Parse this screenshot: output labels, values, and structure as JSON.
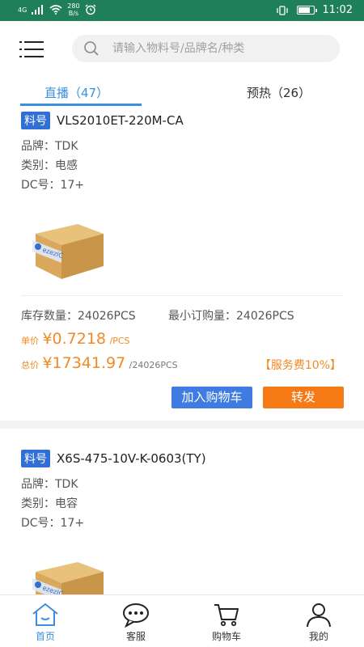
{
  "status_bar": {
    "network": "4G",
    "net_speed_value": "280",
    "net_speed_unit": "B/s",
    "time": "11:02"
  },
  "search": {
    "placeholder": "请输入物料号/品牌名/种类"
  },
  "tabs": [
    {
      "label": "直播（47）",
      "active": true
    },
    {
      "label": "预热（26）",
      "active": false
    }
  ],
  "products": [
    {
      "badge": "料号",
      "part_number": "VLS2010ET-220M-CA",
      "brand": "品牌：TDK",
      "category": "类别：电感",
      "dc": "DC号：17+",
      "stock": "库存数量：24026PCS",
      "moq": "最小订购量：24026PCS",
      "unit_price_label": "单价",
      "unit_price": "¥0.7218",
      "unit_price_unit": "/PCS",
      "total_label": "总价",
      "total_price": "¥17341.97",
      "total_qty": "/24026PCS",
      "service_fee": "【服务费10%】",
      "add_cart": "加入购物车",
      "forward": "转发",
      "image_brand": "ezezIC"
    },
    {
      "badge": "料号",
      "part_number": "X6S-475-10V-K-0603(TY)",
      "brand": "品牌：TDK",
      "category": "类别：电容",
      "dc": "DC号：17+",
      "image_brand": "ezezIC"
    }
  ],
  "bottom_nav": [
    {
      "label": "首页",
      "icon": "home-icon",
      "active": true
    },
    {
      "label": "客服",
      "icon": "chat-icon",
      "active": false
    },
    {
      "label": "购物车",
      "icon": "cart-icon",
      "active": false
    },
    {
      "label": "我的",
      "icon": "user-icon",
      "active": false
    }
  ],
  "colors": {
    "status_bar": "#1e7f5a",
    "accent_blue": "#3b8fe0",
    "orange": "#f08a24",
    "cart_button": "#3f7be0",
    "forward_button": "#f57a16"
  }
}
